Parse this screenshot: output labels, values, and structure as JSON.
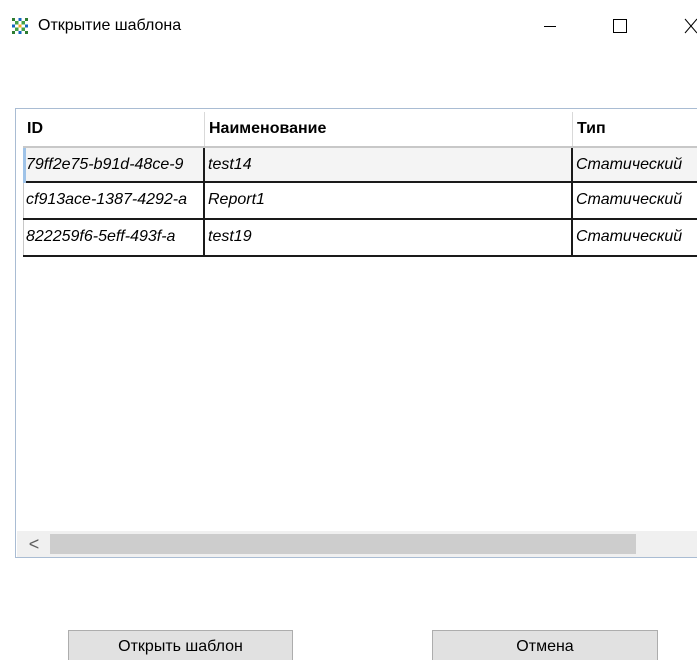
{
  "window": {
    "title": "Открытие шаблона",
    "icon": "app-grid-icon"
  },
  "caption_buttons": {
    "minimize": "minimize-icon",
    "maximize": "maximize-icon",
    "close": "close-icon"
  },
  "grid": {
    "columns": [
      "ID",
      "Наименование",
      "Тип"
    ],
    "rows": [
      [
        "79ff2e75-b91d-48ce-9",
        "test14",
        "Статический"
      ],
      [
        "cf913ace-1387-4292-a",
        "Report1",
        "Статический"
      ],
      [
        "822259f6-5eff-493f-a",
        "test19",
        "Статический"
      ]
    ],
    "scroll_left_glyph": "<"
  },
  "buttons": {
    "open_label": "Открыть шаблон",
    "cancel_label": "Отмена"
  },
  "colors": {
    "grid_border": "#a9bcd3",
    "scroll_thumb": "#cdcdcd",
    "button_face": "#e1e1e1",
    "focus_marker": "#9fc3e8"
  }
}
